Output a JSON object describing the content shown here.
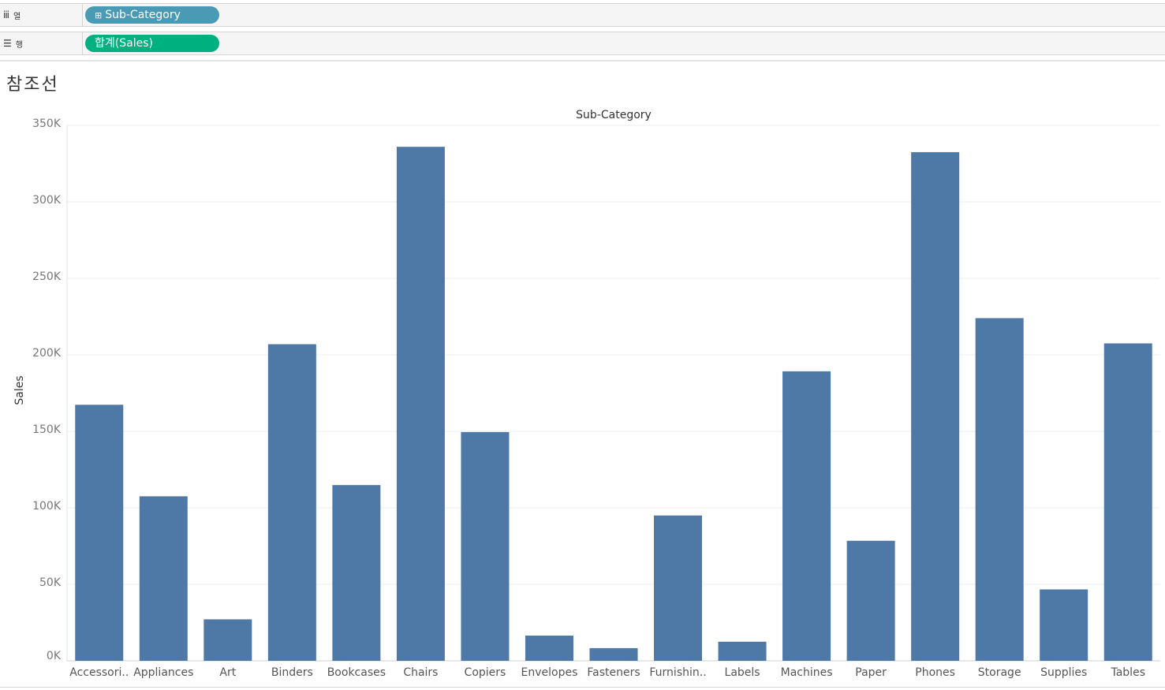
{
  "shelves": {
    "columns": {
      "icon": "columns-shelf-icon",
      "label": "열",
      "pill": "Sub-Category",
      "pill_icon": "expand-plus-icon"
    },
    "rows": {
      "icon": "rows-shelf-icon",
      "label": "행",
      "pill": "합계(Sales)"
    }
  },
  "sheet": {
    "title": "참조선"
  },
  "colors": {
    "bar": "#4e79a7",
    "grid": "#ececec",
    "tick": "#777777",
    "dimension_pill": "#4a9ab5",
    "measure_pill": "#00b180"
  },
  "chart_data": {
    "type": "bar",
    "title": "Sub-Category",
    "xlabel": "",
    "ylabel": "Sales",
    "ylim": [
      0,
      350000
    ],
    "yticks": [
      "0K",
      "50K",
      "100K",
      "150K",
      "200K",
      "250K",
      "300K",
      "350K"
    ],
    "categories": [
      "Accessori..",
      "Appliances",
      "Art",
      "Binders",
      "Bookcases",
      "Chairs",
      "Copiers",
      "Envelopes",
      "Fasteners",
      "Furnishin..",
      "Labels",
      "Machines",
      "Paper",
      "Phones",
      "Storage",
      "Supplies",
      "Tables"
    ],
    "values": [
      167380,
      107532,
      27119,
      206965,
      114880,
      336000,
      149528,
      16476,
      8300,
      95000,
      12486,
      189239,
      78479,
      332500,
      224000,
      46674,
      207500
    ],
    "grid": true,
    "legend": "none"
  }
}
